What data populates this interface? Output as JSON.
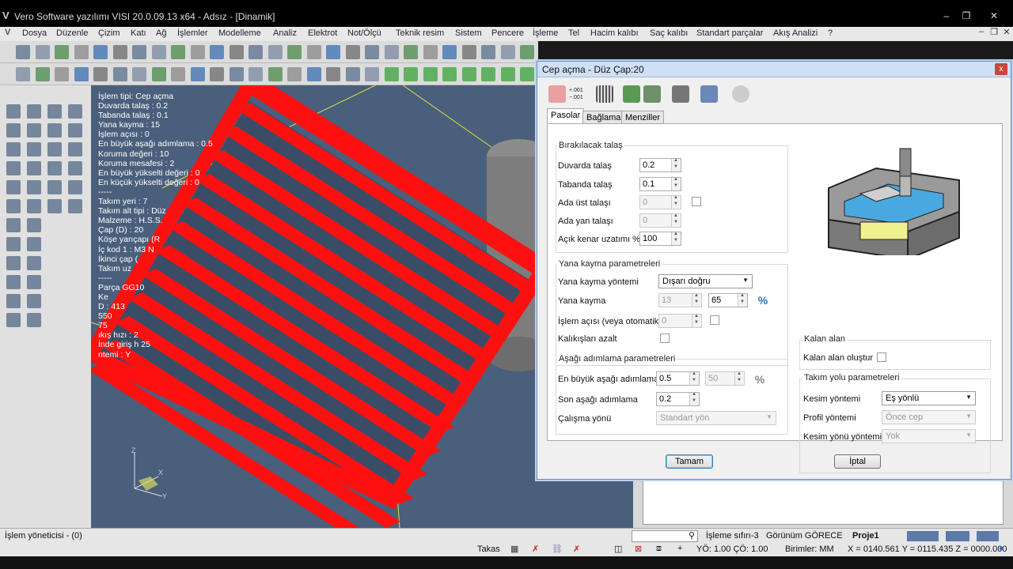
{
  "window": {
    "title": "Vero Software yazılımı VISI 20.0.09.13 x64 - Adsız - [Dinamik]",
    "logo": "V"
  },
  "menu": [
    "Dosya",
    "Düzenle",
    "Çizim",
    "Katı",
    "Ağ",
    "İşlemler",
    "Modelleme",
    "Analiz",
    "Elektrot",
    "Not/Ölçü",
    "Teknik resim",
    "Sistem",
    "Pencere",
    "İşleme",
    "Tel",
    "Hacim kalıbı",
    "Saç kalıbı",
    "Standart parçalar",
    "Akış Analizi",
    "?"
  ],
  "info_lines": [
    "İşlem tipi: Cep açma",
    "Duvarda talaş : 0.2",
    "Tabanda talaş : 0.1",
    "Yana kayma : 15",
    "İşlem açısı : 0",
    "En büyük aşağı adımlama : 0.5",
    "Koruma değeri : 10",
    "Koruma mesafesi : 2",
    "En büyük yükselti değeri : 0",
    "En küçük yükselti değeri : 0",
    "-----",
    "Takım yeri : 7",
    "Takım alt tipi : Düz",
    "Malzeme : H.S.S.",
    "Çap (D) : 20",
    "Köşe yarıçapı (R",
    "İç kod 1 : M3         N",
    "İkinci çap (",
    "Takım uz",
    "-----",
    "Parça          GG10",
    "Ke",
    "D         : 413",
    "            550",
    "                 75",
    "ıkış hızı : 2",
    "İnde giriş h             25",
    "           ntemi : Y"
  ],
  "dialog": {
    "title": "Cep açma - Düz Çap:20",
    "close": "x",
    "tabs": [
      "Pasolar",
      "Bağlama",
      "Menziller"
    ],
    "groups": {
      "remaining_stock": "Bırakılacak talaş",
      "stepover": "Yana kayma parametreleri",
      "stepdown": "Aşağı adımlama parametreleri",
      "rest_area": "Kalan alan",
      "toolpath": "Takım yolu parametreleri"
    },
    "fields": {
      "wall_stock": {
        "label": "Duvarda talaş",
        "value": "0.2"
      },
      "floor_stock": {
        "label": "Tabanda talaş",
        "value": "0.1"
      },
      "island_top": {
        "label": "Ada üst talaşı",
        "value": "0"
      },
      "island_side": {
        "label": "Ada yan talaşı",
        "value": "0"
      },
      "open_edge": {
        "label": "Açık kenar uzatımı %",
        "value": "100"
      },
      "stepover_method": {
        "label": "Yana kayma yöntemi",
        "value": "Dışarı doğru"
      },
      "stepover": {
        "label": "Yana kayma",
        "value_abs": "13",
        "value_pct": "65",
        "pct": "%"
      },
      "angle": {
        "label": "İşlem açısı (veya otomatik)",
        "value": "0"
      },
      "reduce_remnants": {
        "label": "Kalıkışları azalt"
      },
      "max_stepdown": {
        "label": "En büyük aşağı adımlama",
        "value": "0.5",
        "value_pct": "50",
        "pct": "%"
      },
      "last_stepdown": {
        "label": "Son aşağı adımlama",
        "value": "0.2"
      },
      "work_direction": {
        "label": "Çalışma yönü",
        "value": "Standart yön"
      },
      "create_rest": {
        "label": "Kalan alan oluştur"
      },
      "cut_method": {
        "label": "Kesim yöntemi",
        "value": "Eş yönlü"
      },
      "profile_method": {
        "label": "Profil yöntemi",
        "value": "Önce cep"
      },
      "cut_direction": {
        "label": "Kesim yönü yöntemi",
        "value": "Yok"
      }
    },
    "buttons": {
      "ok": "Tamam",
      "cancel": "İptal"
    },
    "toolbar_icons": [
      "box-icon",
      "offset-icon",
      "grid-icon",
      "gear-arrow-icon",
      "gear-icon",
      "save-icon",
      "transform-icon",
      "disabled-icon"
    ],
    "offset_icon_text": [
      "+.001",
      "−.001"
    ]
  },
  "status": {
    "manager": "İşlem yöneticisi - (0)",
    "origin": "İşleme sıfırı-3",
    "view": "Görünüm GÖRECE",
    "project": "Proje1",
    "takas": "Takas",
    "scale": "YÖ: 1.00 ÇÖ: 1.00",
    "units": "Birimler: MM",
    "coords": "X = 0140.561 Y = 0115.435 Z = 0000.000"
  },
  "axis": {
    "x": "X",
    "y": "Y",
    "z": "Z"
  },
  "colors": {
    "toolpath": "#ff1010",
    "viewport": "#4a5f7c",
    "accent": "#2a6fd0"
  }
}
